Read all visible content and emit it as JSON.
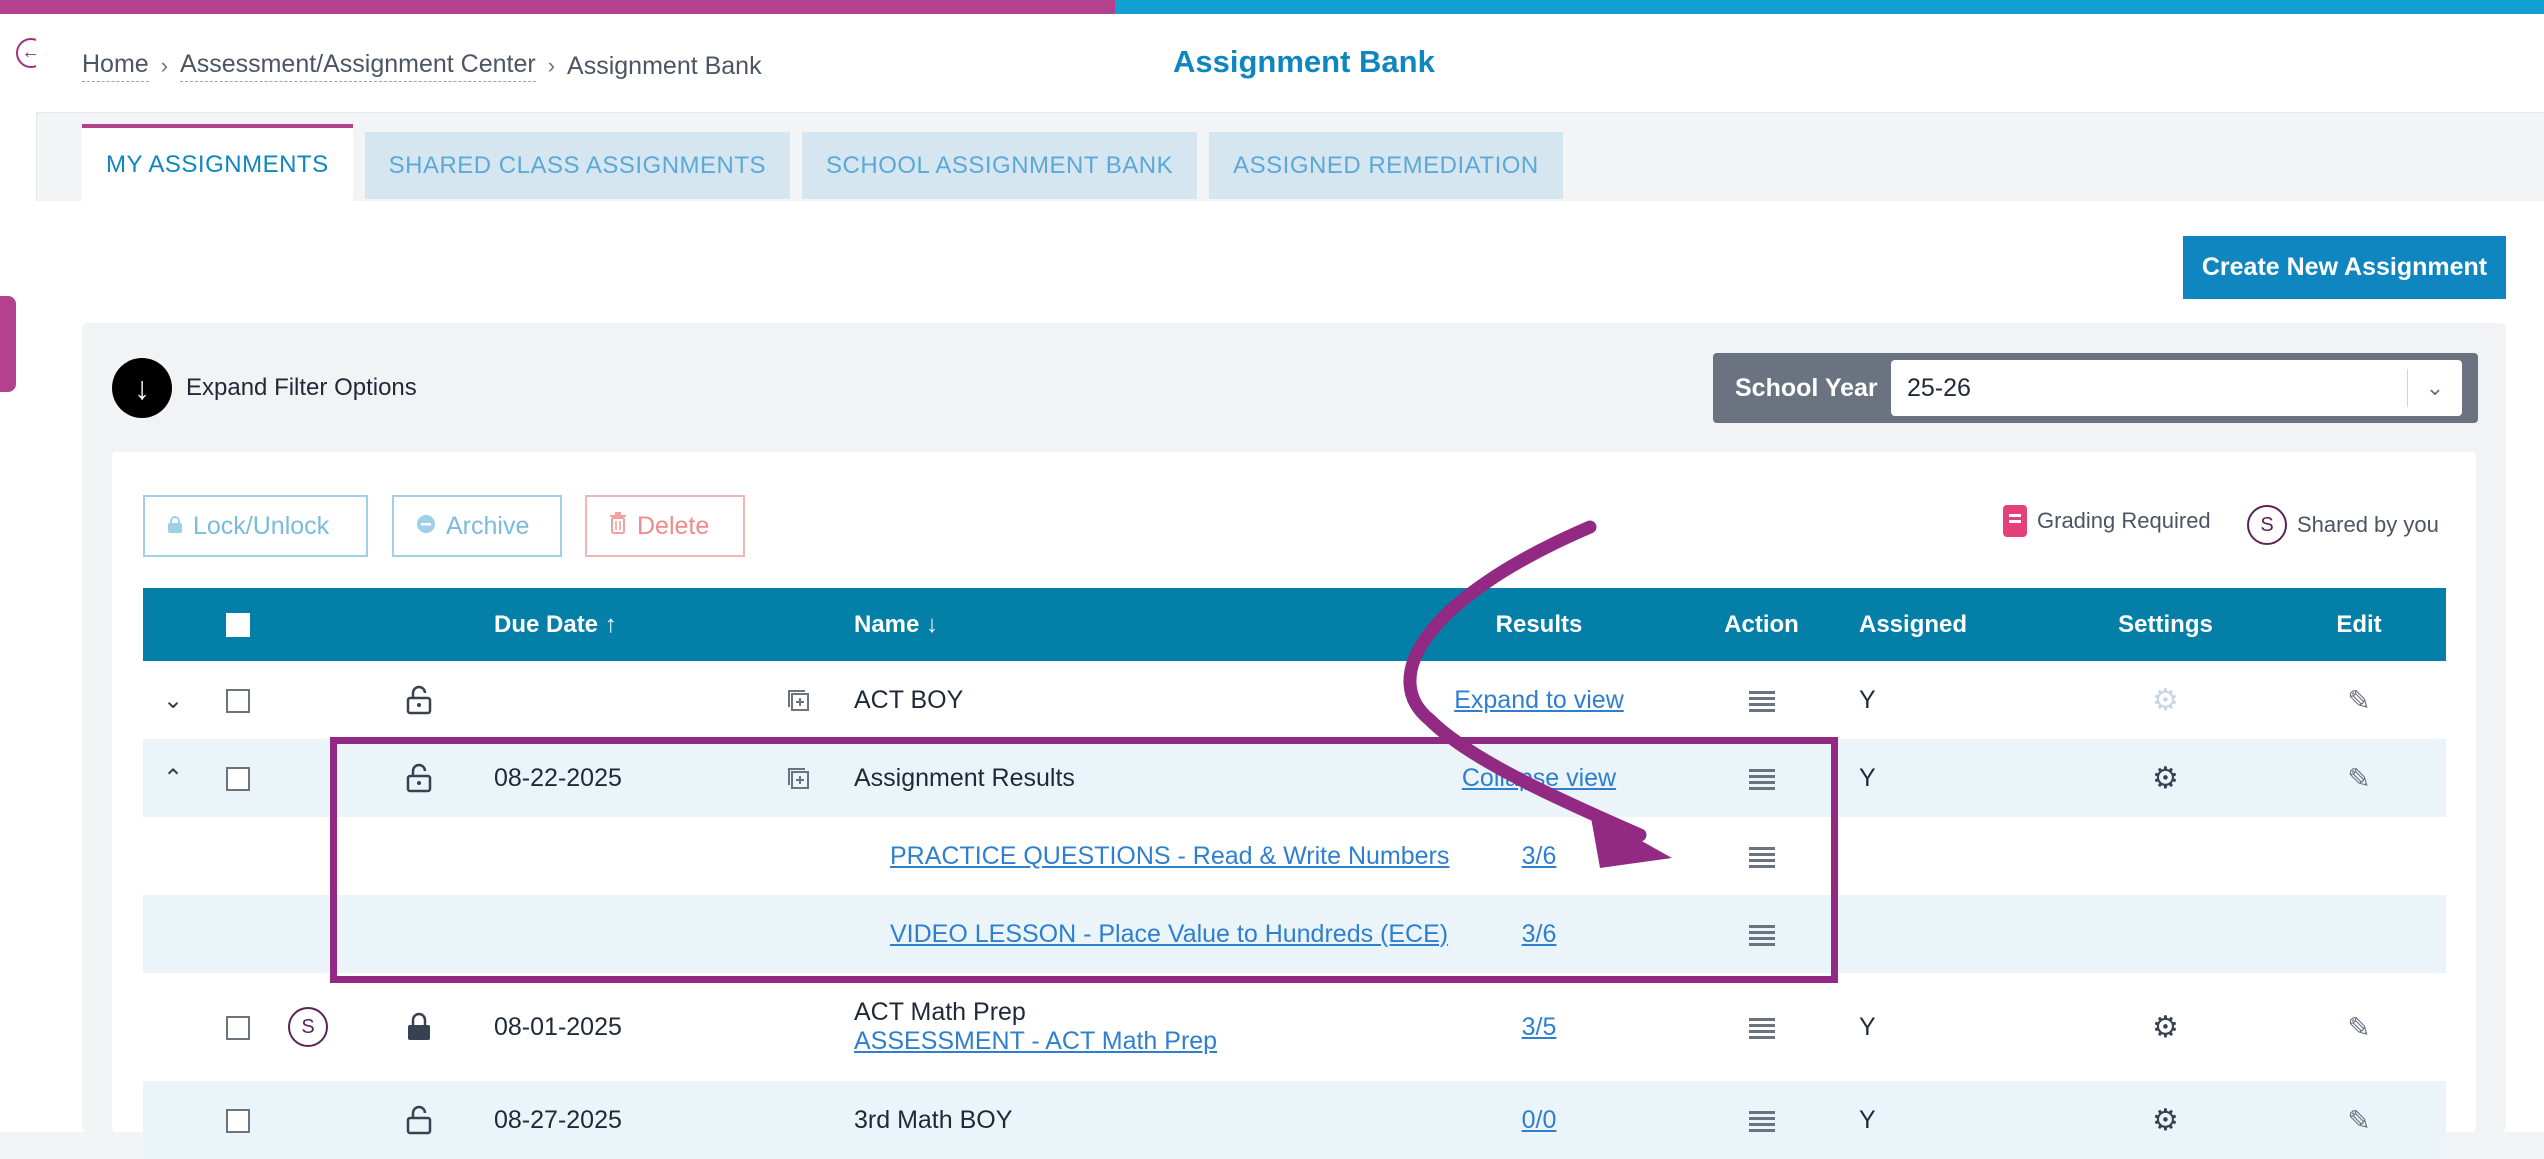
{
  "breadcrumb": {
    "home": "Home",
    "center": "Assessment/Assignment Center",
    "current": "Assignment Bank"
  },
  "page_title": "Assignment Bank",
  "tabs": [
    {
      "label": "MY ASSIGNMENTS",
      "active": true
    },
    {
      "label": "SHARED CLASS ASSIGNMENTS"
    },
    {
      "label": "SCHOOL ASSIGNMENT BANK"
    },
    {
      "label": "ASSIGNED REMEDIATION"
    }
  ],
  "create_button": "Create New Assignment",
  "filter": {
    "expand_label": "Expand Filter Options"
  },
  "school_year": {
    "label": "School Year",
    "value": "25-26"
  },
  "toolbar": {
    "lock": "Lock/Unlock",
    "archive": "Archive",
    "delete": "Delete"
  },
  "legend": {
    "grading": "Grading Required",
    "shared": "Shared by you",
    "shared_badge": "S"
  },
  "table": {
    "headers": {
      "due_date": "Due Date",
      "name": "Name",
      "results": "Results",
      "action": "Action",
      "assigned": "Assigned",
      "settings": "Settings",
      "edit": "Edit"
    },
    "rows": [
      {
        "due": "",
        "name": "ACT BOY",
        "results": "Expand to view",
        "assigned": "Y"
      },
      {
        "due": "08-22-2025",
        "name": "Assignment Results",
        "results": "Collapse view",
        "assigned": "Y"
      },
      {
        "name": "PRACTICE QUESTIONS - Read & Write Numbers",
        "results": "3/6"
      },
      {
        "name": "VIDEO LESSON - Place Value to Hundreds (ECE)",
        "results": "3/6"
      },
      {
        "badge": "S",
        "due": "08-01-2025",
        "name": "ACT Math Prep",
        "sub": "ASSESSMENT - ACT Math Prep",
        "results": "3/5",
        "assigned": "Y"
      },
      {
        "due": "08-27-2025",
        "name": "3rd Math BOY",
        "results": "0/0",
        "assigned": "Y"
      }
    ]
  },
  "colors": {
    "accent": "#0f86bf",
    "header_row": "#0480a8",
    "brand_purple": "#b4418e",
    "annotation": "#922a83"
  }
}
